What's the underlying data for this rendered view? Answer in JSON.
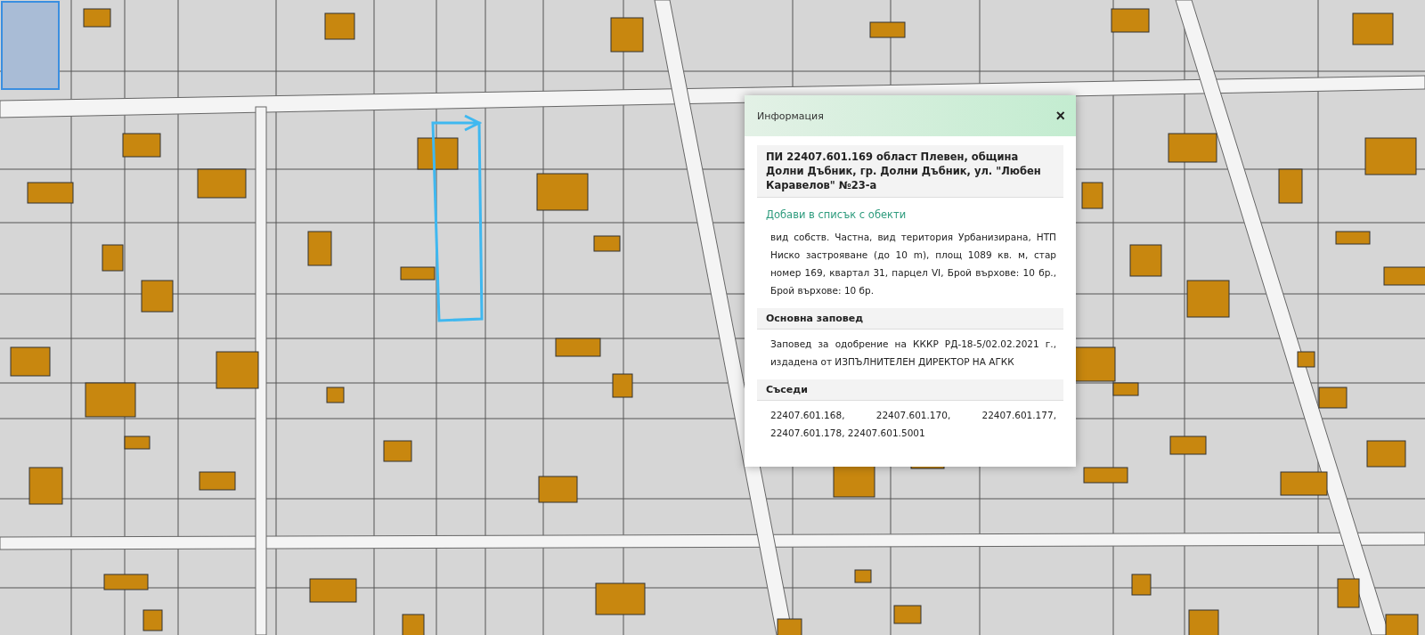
{
  "info_panel": {
    "title": "Информация",
    "close": "×",
    "parcel_heading": "ПИ 22407.601.169 област Плевен, община Долни Дъбник, гр. Долни Дъбник, ул. \"Любен Каравелов\" №23-а",
    "add_link": "Добави в списък с обекти",
    "description": "вид собств. Частна, вид територия Урбанизирана, НТП Ниско застрояване (до 10 m), площ 1089 кв. м, стар номер 169, квартал 31, парцел VI, Брой върхове: 10 бр., Брой върхове: 10 бр.",
    "sections": [
      {
        "heading": "Основна заповед",
        "body": "Заповед за одобрение на КККР РД-18-5/02.02.2021 г., издадена от ИЗПЪЛНИТЕЛЕН ДИРЕКТОР НА АГКК"
      },
      {
        "heading": "Съседи",
        "body": "22407.601.168, 22407.601.170, 22407.601.177, 22407.601.178, 22407.601.5001"
      }
    ]
  }
}
